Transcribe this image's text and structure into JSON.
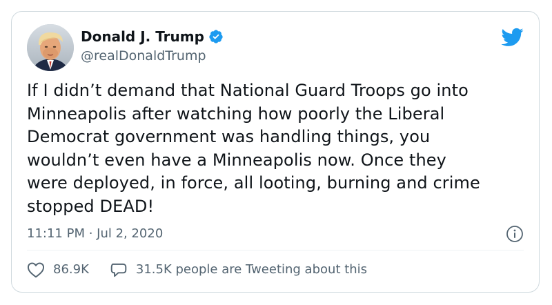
{
  "tweet": {
    "author": {
      "display_name": "Donald J. Trump",
      "handle": "@realDonaldTrump",
      "verified": true,
      "avatar": "profile-photo"
    },
    "text": "If I didn’t demand that National Guard Troops go into\nMinneapolis after watching how poorly the Liberal\nDemocrat government was handling things, you\nwouldn’t even have a Minneapolis now. Once they\nwere deployed, in force, all looting, burning and crime\nstopped DEAD!",
    "timestamp": "11:11 PM · Jul 2, 2020",
    "likes": "86.9K",
    "tweeting_about": "31.5K people are Tweeting about this"
  },
  "icons": {
    "brand": "twitter-bird-icon",
    "verified": "verified-badge-icon",
    "info": "info-icon",
    "like": "heart-icon",
    "reply": "speech-bubble-icon"
  },
  "colors": {
    "twitter_blue": "#1d9bf0",
    "text_primary": "#0f1419",
    "text_secondary": "#536471",
    "border": "#cfd9de"
  }
}
